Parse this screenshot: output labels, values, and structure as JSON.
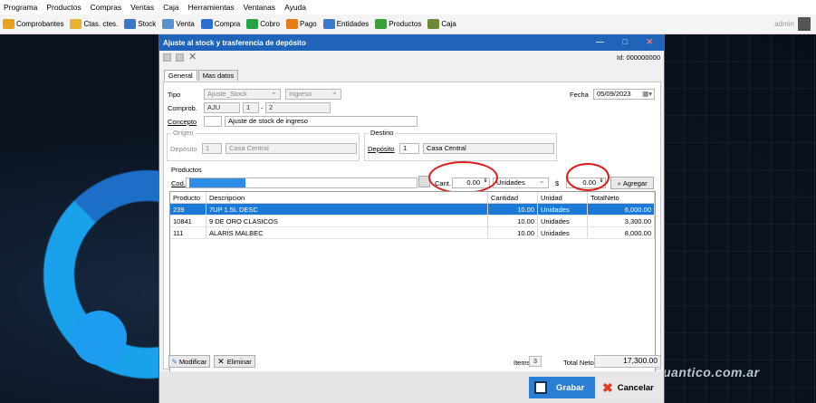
{
  "menubar": [
    "Programa",
    "Productos",
    "Compras",
    "Ventas",
    "Caja",
    "Herramientas",
    "Ventanas",
    "Ayuda"
  ],
  "toolbar": [
    {
      "label": "Comprobantes",
      "icon": "documents-icon",
      "color": "#e8a11c"
    },
    {
      "label": "Ctas. ctes.",
      "icon": "folder-icon",
      "color": "#e6b234"
    },
    {
      "label": "Stock",
      "icon": "stock-icon",
      "color": "#3a78c8"
    },
    {
      "label": "Venta",
      "icon": "sale-icon",
      "color": "#5a8fd0"
    },
    {
      "label": "Compra",
      "icon": "cart-icon",
      "color": "#2a6fd0"
    },
    {
      "label": "Cobro",
      "icon": "cobro-icon",
      "color": "#24a444"
    },
    {
      "label": "Pago",
      "icon": "pago-icon",
      "color": "#e47a18"
    },
    {
      "label": "Entidades",
      "icon": "entities-icon",
      "color": "#3a7acc"
    },
    {
      "label": "Productos",
      "icon": "products-icon",
      "color": "#3c9e3a"
    },
    {
      "label": "Caja",
      "icon": "cashbox-icon",
      "color": "#6a8a3a"
    }
  ],
  "user": "admin",
  "brand_text": "uantico.com.ar",
  "dialog": {
    "title": "Ajuste al stock y trasferencia de depósito",
    "id_label": "Id: 000000000",
    "tabs": [
      "General",
      "Mas datos"
    ],
    "tipo_label": "Tipo",
    "tipo_value": "Ajuste_Stock",
    "tipo2_value": "Ingreso",
    "fecha_label": "Fecha",
    "fecha_value": "05/09/2023",
    "comprob_label": "Comprob.",
    "comprob_type": "AJU",
    "comprob_a": "1",
    "comprob_b": "2",
    "concepto_label": "Concepto",
    "concepto_value": "Ajuste de stock de ingreso",
    "origen_label": "Origen",
    "origen_deposito_label": "Depósito",
    "origen_deposito_num": "1",
    "origen_deposito_name": "Casa Central",
    "destino_label": "Destino",
    "destino_deposito_label": "Depósito",
    "destino_deposito_num": "1",
    "destino_deposito_name": "Casa Central",
    "productos_label": "Productos",
    "cod_label": "Cod.",
    "cant_label": "Cant.",
    "cant_value": "0.00",
    "unidad_value": "Unidades",
    "precio_label": "$",
    "precio_value": "0.00",
    "agregar_label": "Agregar",
    "grid_headers": [
      "Producto",
      "Descripcion",
      "Cantidad",
      "Unidad",
      "TotalNeto"
    ],
    "rows": [
      {
        "producto": "239",
        "descripcion": "7UP 1.5L DESC",
        "cantidad": "10.00",
        "unidad": "Unidades",
        "total": "6,000.00"
      },
      {
        "producto": "10841",
        "descripcion": "9 DE ORO CLASICOS",
        "cantidad": "10.00",
        "unidad": "Unidades",
        "total": "3,300.00"
      },
      {
        "producto": "111",
        "descripcion": "ALARIS MALBEC",
        "cantidad": "10.00",
        "unidad": "Unidades",
        "total": "8,000.00"
      }
    ],
    "modificar_label": "Modificar",
    "eliminar_label": "Eliminar",
    "items_label": "Items",
    "items_value": "3",
    "total_neto_label": "Total Neto",
    "total_neto_value": "17,300.00",
    "grabar_label": "Grabar",
    "cancelar_label": "Cancelar"
  }
}
